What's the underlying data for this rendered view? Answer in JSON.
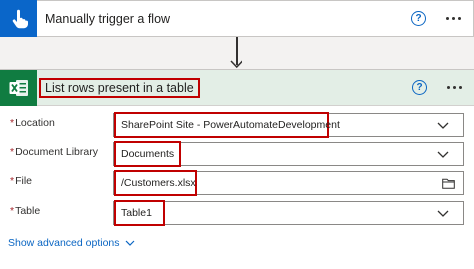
{
  "trigger": {
    "title": "Manually trigger a flow",
    "icon": "hand-touch-icon",
    "accent": "#0a66c9"
  },
  "action": {
    "title": "List rows present in a table",
    "icon": "excel-icon",
    "accent": "#107c41",
    "header_bg": "#e3eee6"
  },
  "fields": [
    {
      "label": "Location",
      "required": true,
      "value": "SharePoint Site - PowerAutomateDevelopment",
      "control": "dropdown"
    },
    {
      "label": "Document Library",
      "required": true,
      "value": "Documents",
      "control": "dropdown"
    },
    {
      "label": "File",
      "required": true,
      "value": "/Customers.xlsx",
      "control": "file-picker"
    },
    {
      "label": "Table",
      "required": true,
      "value": "Table1",
      "control": "dropdown"
    }
  ],
  "advanced": {
    "label": "Show advanced options"
  },
  "highlight_color": "#c00000"
}
